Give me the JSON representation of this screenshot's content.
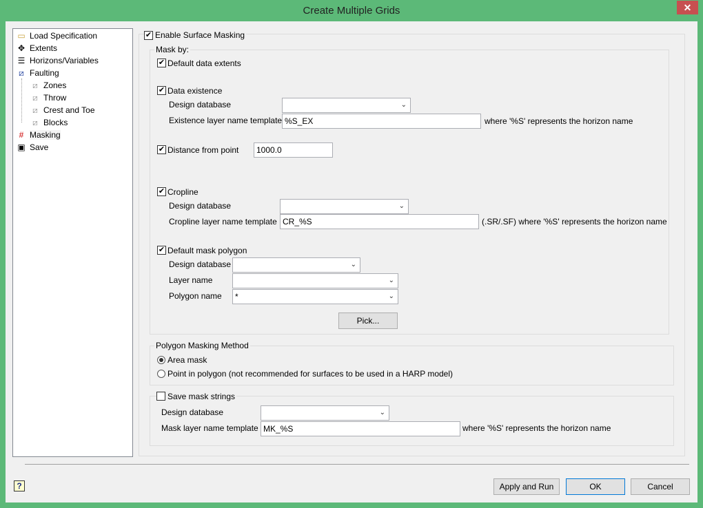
{
  "window": {
    "title": "Create Multiple Grids",
    "close": "✕"
  },
  "tree": [
    {
      "label": "Load Specification",
      "icon": "folder-icon"
    },
    {
      "label": "Extents",
      "icon": "move-arrows-icon"
    },
    {
      "label": "Horizons/Variables",
      "icon": "layers-icon"
    },
    {
      "label": "Faulting",
      "icon": "fault-icon"
    },
    {
      "label": "Zones",
      "icon": "fault-icon"
    },
    {
      "label": "Throw",
      "icon": "fault-icon"
    },
    {
      "label": "Crest and Toe",
      "icon": "fault-icon"
    },
    {
      "label": "Blocks",
      "icon": "fault-icon"
    },
    {
      "label": "Masking",
      "icon": "grid-icon"
    },
    {
      "label": "Save",
      "icon": "floppy-disk-icon"
    }
  ],
  "masking": {
    "enable": "Enable Surface Masking",
    "mask_by": "Mask by:",
    "default_extents": "Default data extents",
    "data_existence": "Data existence",
    "design_database": "Design database",
    "existence_template_label": "Existence layer name template",
    "existence_template_value": "%S_EX",
    "existence_hint": "where '%S' represents the horizon name",
    "distance": "Distance from point",
    "distance_value": "1000.0",
    "cropline": "Cropline",
    "cropline_template_label": "Cropline layer name template",
    "cropline_template_value": "CR_%S",
    "cropline_hint": "(.SR/.SF) where '%S' represents the horizon name",
    "default_polygon": "Default mask polygon",
    "layer_name": "Layer name",
    "polygon_name": "Polygon name",
    "polygon_name_value": "*",
    "pick": "Pick...",
    "method_title": "Polygon Masking Method",
    "area_mask": "Area mask",
    "point_in_polygon": "Point in polygon (not recommended for surfaces to be used in a HARP model)",
    "save_strings": "Save mask strings",
    "mask_template_label": "Mask layer name template",
    "mask_template_value": "MK_%S",
    "mask_hint": "where '%S' represents the horizon name"
  },
  "footer": {
    "apply": "Apply and Run",
    "ok": "OK",
    "cancel": "Cancel",
    "help": "?"
  }
}
